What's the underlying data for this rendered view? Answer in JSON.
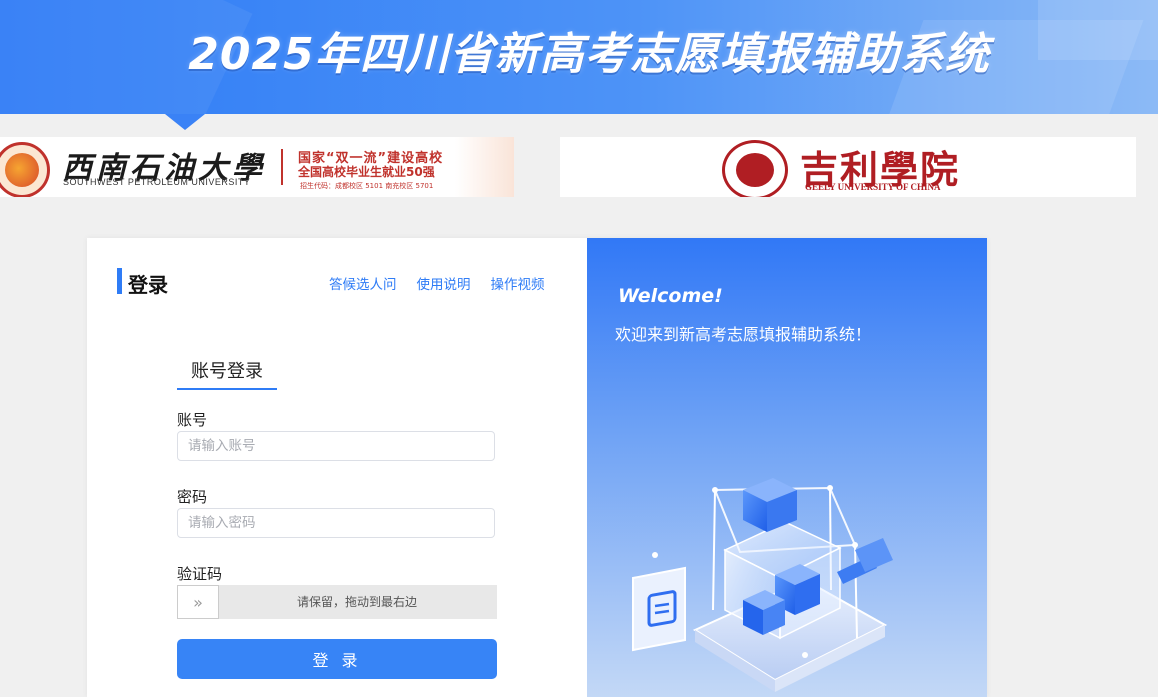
{
  "banner": {
    "title": "2025年四川省新高考志愿填报辅助系统"
  },
  "logos": {
    "left": {
      "name_cn": "西南石油大學",
      "name_en": "SOUTHWEST PETROLEUM UNIVERSITY",
      "tag_line1": "国家“双一流”建设高校",
      "tag_line2": "全国高校毕业生就业50强",
      "tag_line3": "招生代码：成都校区 5101  南充校区 5701"
    },
    "right": {
      "name_cn": "吉利學院",
      "name_en": "GEELY UNIVERSITY OF CHINA"
    }
  },
  "login": {
    "title": "登录",
    "links": [
      "答候选人问",
      "使用说明",
      "操作视频"
    ],
    "tab_label": "账号登录",
    "account_label": "账号",
    "account_placeholder": "请输入账号",
    "password_label": "密码",
    "password_placeholder": "请输入密码",
    "captcha_label": "验证码",
    "slider_text": "请保留，拖动到最右边",
    "slider_handle_glyph": "»",
    "submit_label": "登 录"
  },
  "welcome": {
    "heading": "Welcome!",
    "subtitle": "欢迎来到新高考志愿填报辅助系统！"
  },
  "colors": {
    "accent": "#2f7cf6",
    "button": "#3784f6",
    "swpu_red": "#c0322c",
    "geely_red": "#b01e23"
  }
}
